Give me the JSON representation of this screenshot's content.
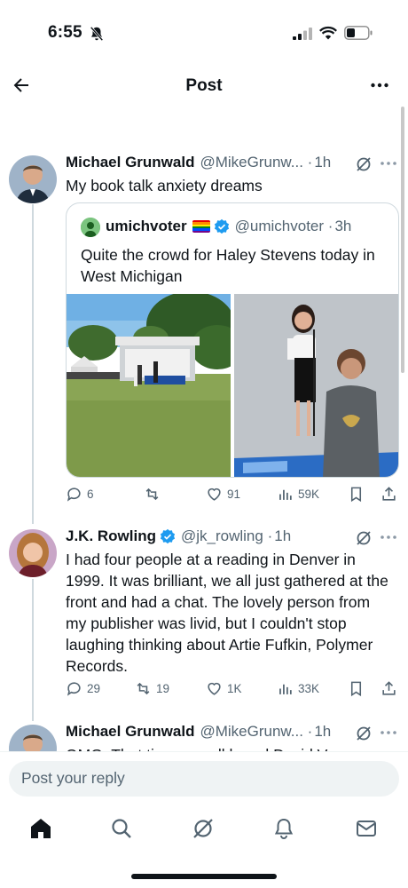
{
  "status_bar": {
    "time": "6:55"
  },
  "header": {
    "title": "Post"
  },
  "tweets": [
    {
      "name": "Michael Grunwald",
      "handle": "@MikeGrunw... ·",
      "time": "1h",
      "text": "My book talk anxiety dreams",
      "quote": {
        "name": "umichvoter",
        "handle": "@umichvoter ·",
        "time": "3h",
        "text": "Quite the crowd for Haley Stevens today in West Michigan"
      },
      "stats": {
        "replies": "6",
        "reposts": "",
        "likes": "91",
        "views": "59K"
      }
    },
    {
      "name": "J.K. Rowling",
      "handle": "@jk_rowling ·",
      "time": "1h",
      "text": "I had four people at a reading in Denver in 1999. It was brilliant, we all just gathered at the front and had a chat. The lovely person from my publisher was livid, but I couldn't stop laughing thinking about Artie Fufkin, Polymer Records.",
      "stats": {
        "replies": "29",
        "reposts": "19",
        "likes": "1K",
        "views": "33K"
      }
    },
    {
      "name": "Michael Grunwald",
      "handle": "@MikeGrunw... ·",
      "time": "1h",
      "text_partial": "OMG. That time you all heard David V..."
    }
  ],
  "reply": {
    "placeholder": "Post your reply"
  },
  "icons": {
    "back": "arrow-left-icon",
    "more": "more-horizontal-icon",
    "verified": "verified-badge-icon",
    "grok": "grok-icon",
    "reply": "reply-icon",
    "repost": "repost-icon",
    "like": "heart-icon",
    "views": "views-icon",
    "bookmark": "bookmark-icon",
    "share": "share-icon",
    "home": "home-icon",
    "search": "search-icon",
    "grok_tab": "grok-icon",
    "notifications": "bell-icon",
    "messages": "mail-icon"
  },
  "colors": {
    "accent": "#1d9bf0",
    "text": "#0f1419",
    "muted": "#536471",
    "border": "#cfd9de"
  }
}
